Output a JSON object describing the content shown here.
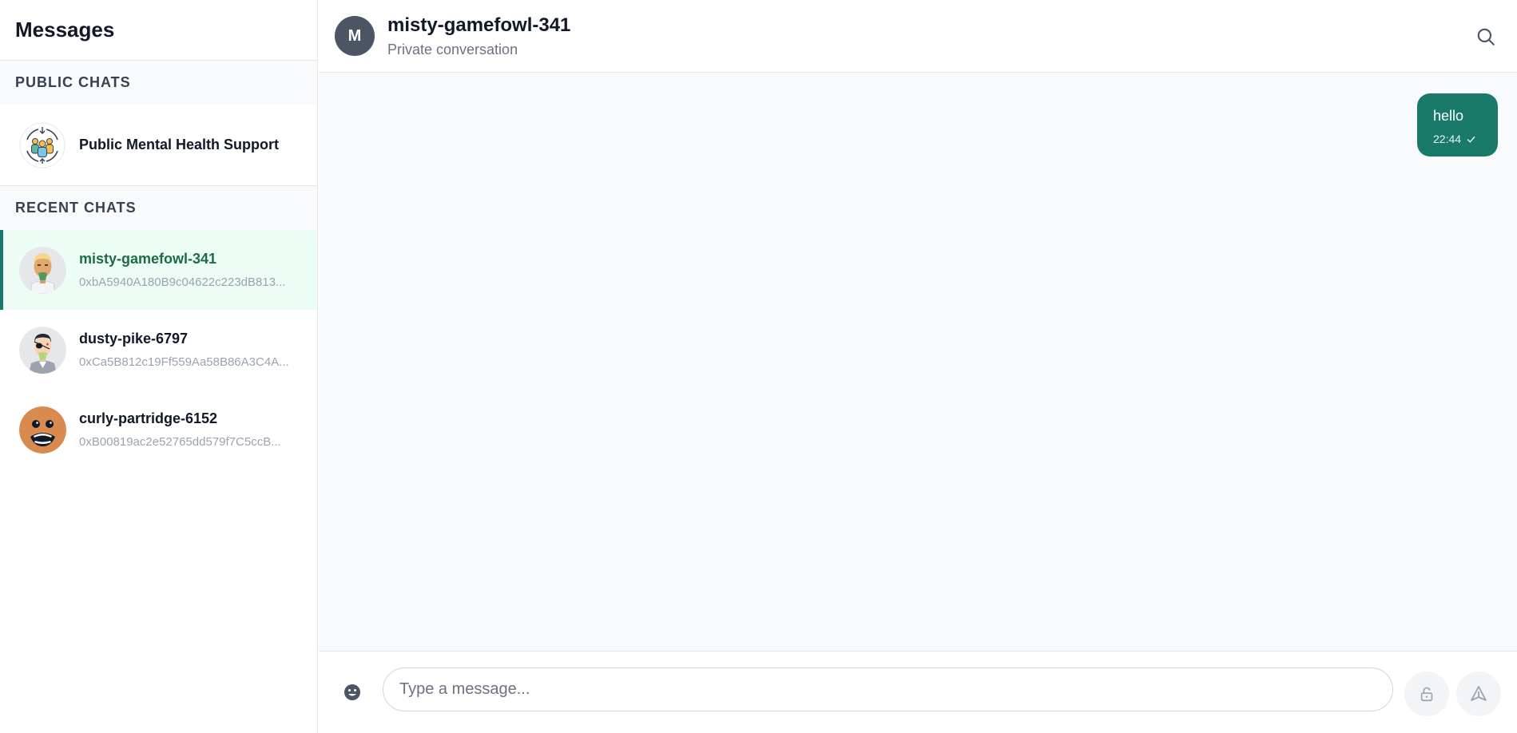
{
  "sidebar": {
    "title": "Messages",
    "public_section_label": "PUBLIC CHATS",
    "public_chats": [
      {
        "name": "Public Mental Health Support",
        "icon": "group-support-icon"
      }
    ],
    "recent_section_label": "RECENT CHATS",
    "recent_chats": [
      {
        "name": "misty-gamefowl-341",
        "address": "0xbA5940A180B9c04622c223dB813...",
        "active": true
      },
      {
        "name": "dusty-pike-6797",
        "address": "0xCa5B812c19Ff559Aa58B86A3C4A...",
        "active": false
      },
      {
        "name": "curly-partridge-6152",
        "address": "0xB00819ac2e52765dd579f7C5ccB...",
        "active": false
      }
    ]
  },
  "chat_header": {
    "avatar_initial": "M",
    "name": "misty-gamefowl-341",
    "subtitle": "Private conversation",
    "search_icon": "search-icon"
  },
  "messages": [
    {
      "text": "hello",
      "time": "22:44",
      "status_icon": "check-icon",
      "outgoing": true
    }
  ],
  "composer": {
    "placeholder": "Type a message...",
    "value": "",
    "emoji_icon": "emoji-icon",
    "lock_icon": "unlock-icon",
    "send_icon": "send-icon"
  },
  "colors": {
    "accent": "#1a7a6a",
    "active_bg": "#ecfdf5",
    "active_name": "#1f6b45",
    "header_avatar_bg": "#4b5563"
  }
}
